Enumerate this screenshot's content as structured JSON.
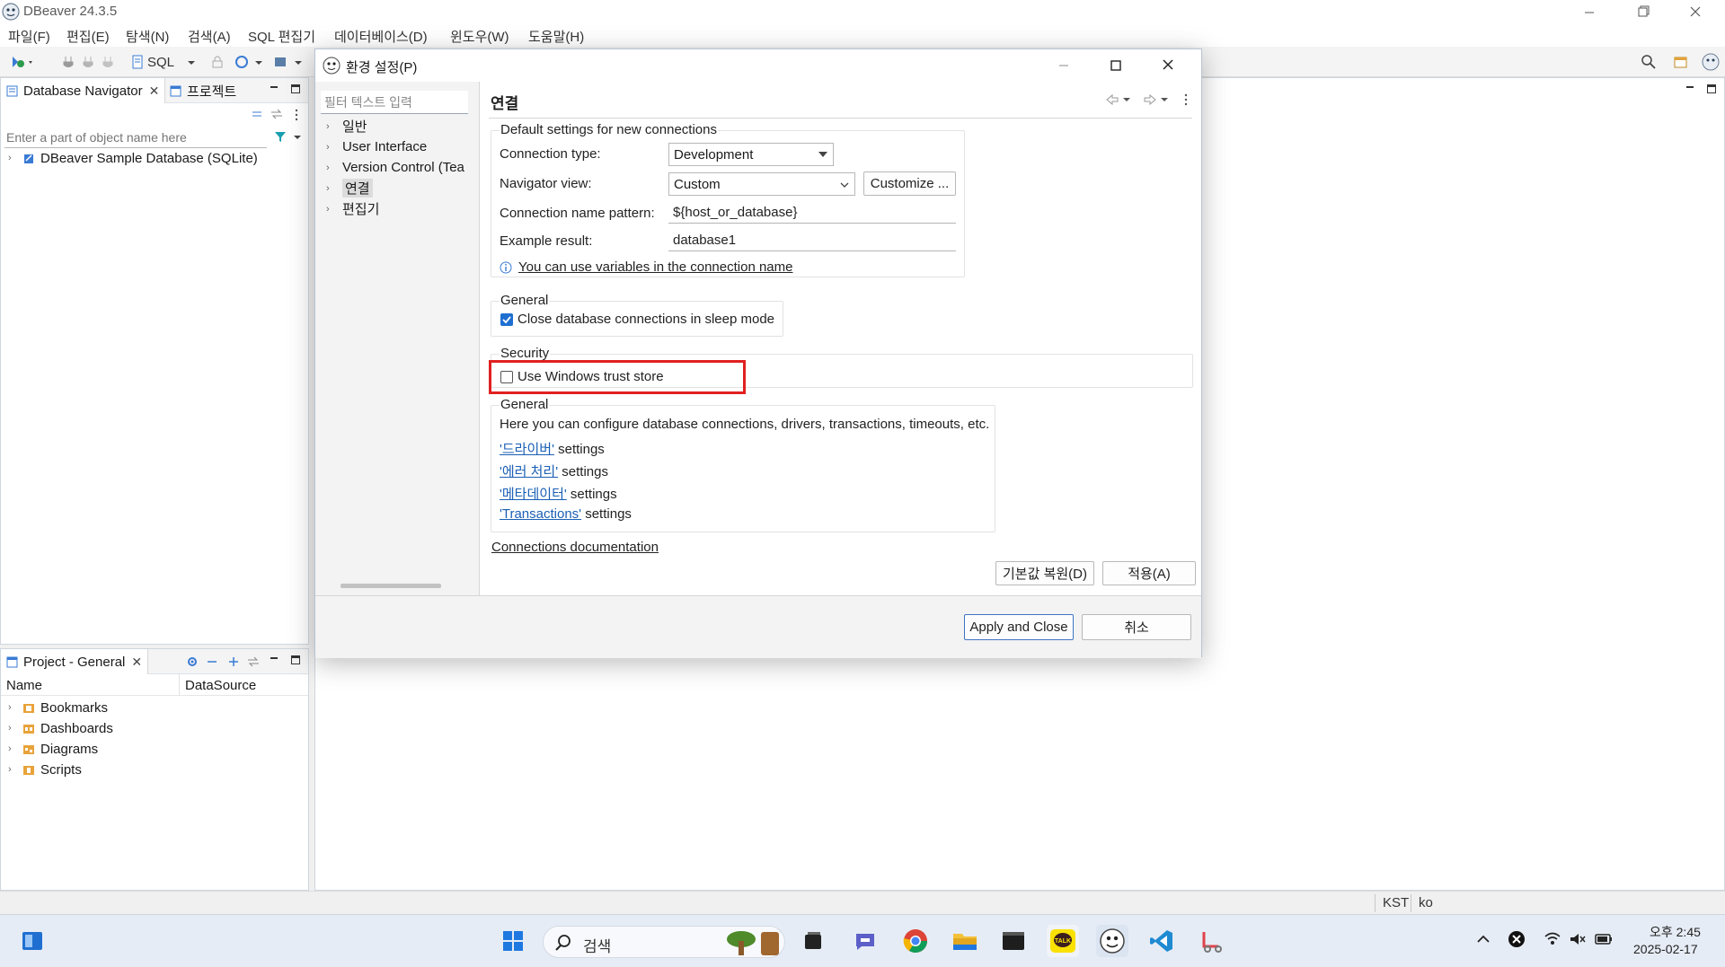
{
  "window": {
    "title": "DBeaver 24.3.5"
  },
  "menu": [
    "파일(F)",
    "편집(E)",
    "탐색(N)",
    "검색(A)",
    "SQL 편집기",
    "데이터베이스(D)",
    "윈도우(W)",
    "도움말(H)"
  ],
  "toolbar": {
    "sql_label": "SQL"
  },
  "navigator": {
    "tab_label": "Database Navigator",
    "projects_tab_label": "프로젝트",
    "search_placeholder": "Enter a part of object name here",
    "items": [
      "DBeaver Sample Database (SQLite)"
    ]
  },
  "project_pane": {
    "tab_label": "Project - General",
    "columns": [
      "Name",
      "DataSource"
    ],
    "items": [
      "Bookmarks",
      "Dashboards",
      "Diagrams",
      "Scripts"
    ]
  },
  "dialog": {
    "title": "환경 설정(P)",
    "filter_placeholder": "필터 텍스트 입력",
    "nav_items": [
      "일반",
      "User Interface",
      "Version Control (Tea",
      "연결",
      "편집기"
    ],
    "page_title": "연결",
    "defaults_group": {
      "label": "Default settings for new connections",
      "connection_type_label": "Connection type:",
      "connection_type_value": "Development",
      "navigator_view_label": "Navigator view:",
      "navigator_view_value": "Custom",
      "customize_button": "Customize ...",
      "name_pattern_label": "Connection name pattern:",
      "name_pattern_value": "${host_or_database}",
      "example_label": "Example result:",
      "example_value": "database1",
      "variables_link": "You can use variables in the connection name"
    },
    "general_group": {
      "label": "General",
      "close_sleep_label": "Close database connections in sleep mode",
      "close_sleep_checked": true
    },
    "security_group": {
      "label": "Security",
      "trust_store_label": "Use Windows trust store",
      "trust_store_checked": false
    },
    "info_group": {
      "label": "General",
      "description": "Here you can configure database connections, drivers, transactions, timeouts, etc.",
      "links": [
        {
          "link": "'드라이버'",
          "suffix": " settings"
        },
        {
          "link": "'에러 처리'",
          "suffix": " settings"
        },
        {
          "link": "'메타데이터'",
          "suffix": " settings"
        },
        {
          "link": "'Transactions'",
          "suffix": " settings"
        }
      ]
    },
    "docs_link": "Connections documentation",
    "restore_defaults_button": "기본값 복원(D)",
    "apply_button": "적용(A)",
    "apply_close_button": "Apply and Close",
    "cancel_button": "취소"
  },
  "statusbar": {
    "timezone": "KST",
    "locale": "ko"
  },
  "taskbar": {
    "search_placeholder": "검색",
    "time": "오후 2:45",
    "date": "2025-02-17"
  },
  "colors": {
    "accent": "#1a5fb4",
    "highlight_box": "#e02020",
    "checkbox_checked": "#1f6fd1"
  }
}
